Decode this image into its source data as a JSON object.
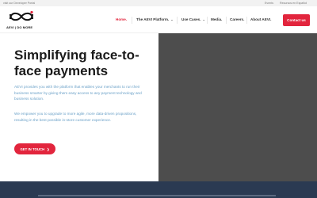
{
  "topbar": {
    "left_link": "visit our Developer Portal",
    "right_links": [
      "Events",
      "Recursos en Español"
    ]
  },
  "logo": {
    "text": "AEVI",
    "tagline": "AEVI | DO MORE"
  },
  "nav": {
    "items": [
      {
        "label": "Home.",
        "active": true
      },
      {
        "label": "The AEVI Platform.",
        "dropdown": true
      },
      {
        "label": "Use Cases.",
        "dropdown": true
      },
      {
        "label": "Media."
      },
      {
        "label": "Careers."
      },
      {
        "label": "About AEVI."
      }
    ],
    "contact_label": "Contact us"
  },
  "hero": {
    "headline": "Simplifying face-to-face payments",
    "paragraph_1": "AEVI provides you with the platform that enables your merchants to run their business smarter by giving them easy access to any payment technology and business solution.",
    "paragraph_2": "We empower you to upgrade to more agile, more data-driven propositions, resulting in the best possible in-store customer experience.",
    "cta_label": "GET IN TOUCH",
    "cta_arrow_icon": "arrow-right-icon"
  },
  "colors": {
    "accent": "#e2253d",
    "body_text": "#6aa0c7",
    "hero_image_bg": "#4d4d4d",
    "footer_band": "#2b3a52"
  }
}
